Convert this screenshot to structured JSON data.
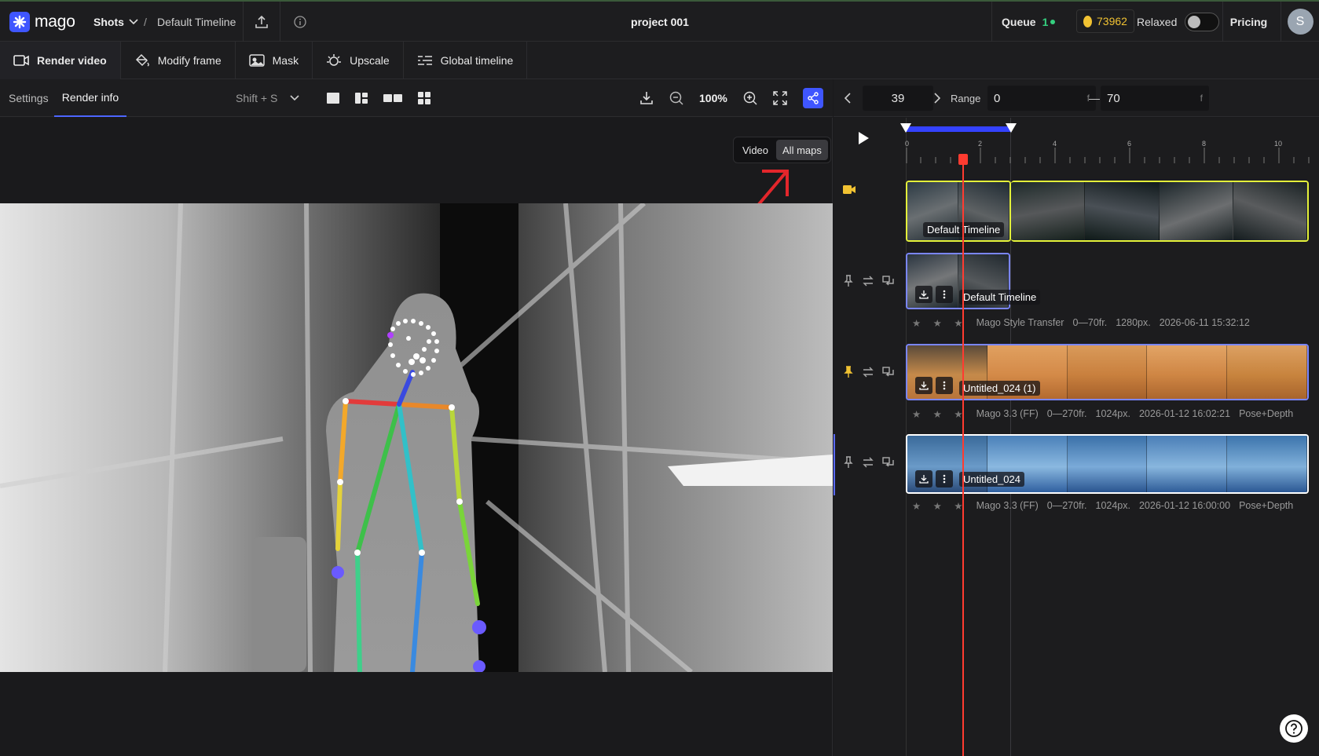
{
  "topbar": {
    "logo_text": "mago",
    "shots_label": "Shots",
    "breadcrumb_sep": "/",
    "breadcrumb_timeline": "Default Timeline",
    "project_title": "project 001",
    "queue_label": "Queue",
    "queue_count": "1",
    "credits": "73962",
    "mode_label": "Relaxed",
    "pricing_label": "Pricing",
    "avatar_initial": "S"
  },
  "toolbar": {
    "render_video": "Render video",
    "modify_frame": "Modify frame",
    "mask": "Mask",
    "upscale": "Upscale",
    "global_timeline": "Global timeline"
  },
  "panel": {
    "tab_settings": "Settings",
    "tab_render_info": "Render info",
    "shortcut": "Shift + S",
    "zoom": "100%"
  },
  "viewer": {
    "toggle_video": "Video",
    "toggle_all_maps": "All maps",
    "active_toggle": "All maps"
  },
  "timeline_header": {
    "current_frame": "39",
    "range_label": "Range",
    "range_start": "0",
    "range_end": "70",
    "frame_unit": "f",
    "range_dash": "—"
  },
  "timeline": {
    "ruler_ticks": [
      "0",
      "2",
      "4",
      "6",
      "8",
      "10"
    ],
    "rows": [
      {
        "clip_label": "Default Timeline",
        "stars": "★ ★ ★",
        "model": "",
        "frames": "",
        "resolution": "",
        "date": "",
        "maps": ""
      },
      {
        "clip_label": "Default Timeline",
        "stars": "★ ★ ★",
        "model": "Mago Style Transfer",
        "frames": "0—70fr.",
        "resolution": "1280px.",
        "date": "2026-06-11 15:32:12",
        "maps": ""
      },
      {
        "clip_label": "Untitled_024 (1)",
        "stars": "★ ★ ★",
        "model": "Mago 3.3 (FF)",
        "frames": "0—270fr.",
        "resolution": "1024px.",
        "date": "2026-01-12 16:02:21",
        "maps": "Pose+Depth"
      },
      {
        "clip_label": "Untitled_024",
        "stars": "★ ★ ★",
        "model": "Mago 3.3 (FF)",
        "frames": "0—270fr.",
        "resolution": "1024px.",
        "date": "2026-01-12 16:00:00",
        "maps": "Pose+Depth"
      }
    ]
  },
  "colors": {
    "accent": "#3f56ff",
    "queue_green": "#35d07f",
    "credits_gold": "#f1c232",
    "playhead": "#ff3b30",
    "selected_clip_border": "#e4f23a",
    "clip_border": "#7a86ff"
  },
  "icons": {
    "logo": "mago-logo-icon",
    "upload": "upload-icon",
    "info": "info-icon",
    "help": "help-icon"
  }
}
